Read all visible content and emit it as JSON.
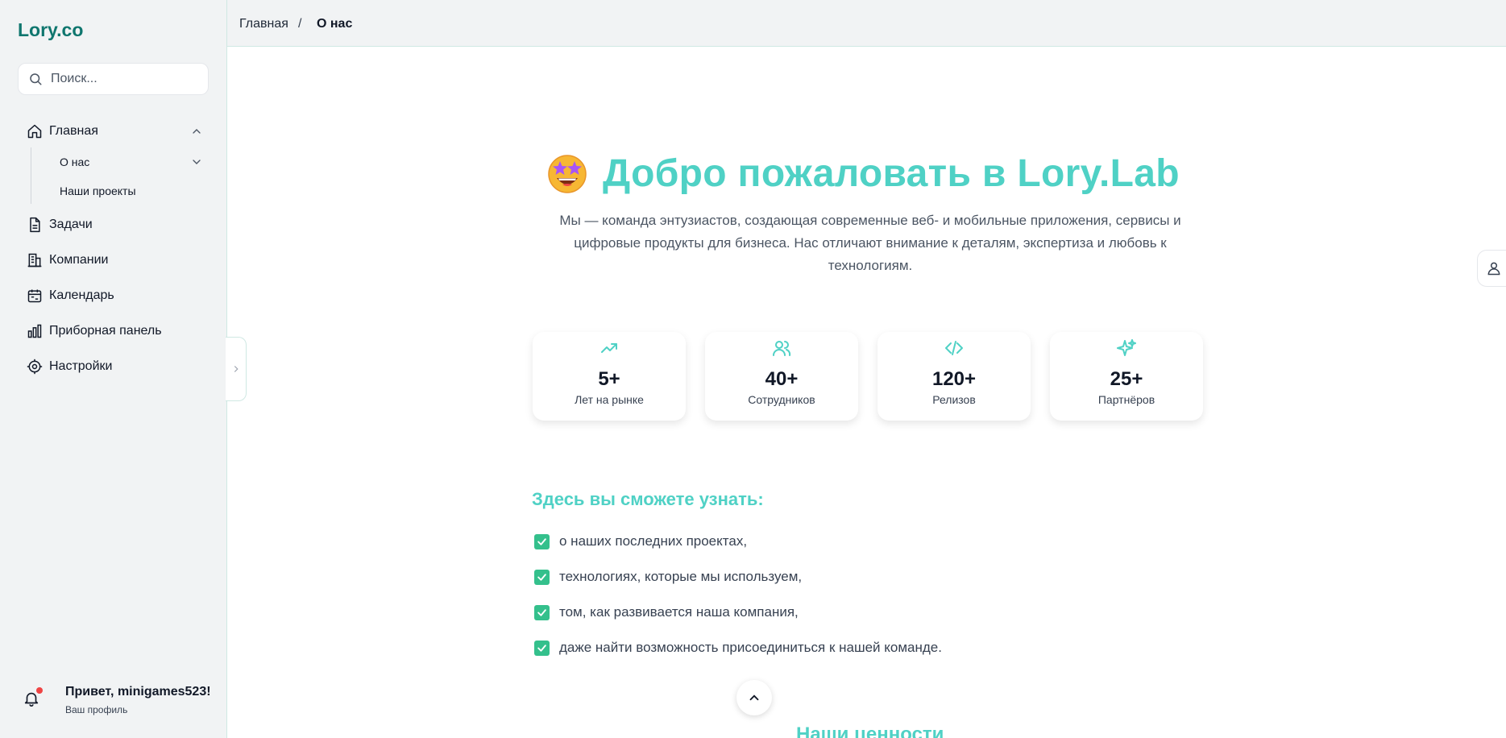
{
  "app": {
    "logo": "Lory.co"
  },
  "search": {
    "placeholder": "Поиск..."
  },
  "nav": {
    "items": [
      {
        "label": "Главная",
        "icon": "home-icon",
        "expanded": true
      },
      {
        "label": "Задачи",
        "icon": "document-icon"
      },
      {
        "label": "Компании",
        "icon": "building-icon"
      },
      {
        "label": "Календарь",
        "icon": "calendar-icon"
      },
      {
        "label": "Приборная панель",
        "icon": "bar-chart-icon"
      },
      {
        "label": "Настройки",
        "icon": "gear-icon"
      }
    ],
    "subitems": [
      {
        "label": "О нас",
        "icon": "chevron-down-icon"
      },
      {
        "label": "Наши проекты"
      }
    ]
  },
  "user": {
    "greeting": "Привет, minigames523!",
    "subtitle": "Ваш профиль"
  },
  "breadcrumb": {
    "home": "Главная",
    "separator": "/",
    "current": "О нас"
  },
  "hero": {
    "title": "Добро пожаловать в Lory.Lab",
    "description": "Мы — команда энтузиастов, создающая современные веб- и мобильные приложения, сервисы и цифровые продукты для бизнеса. Нас отличают внимание к деталям, экспертиза и любовь к технологиям."
  },
  "stats": [
    {
      "value": "5+",
      "label": "Лет на рынке",
      "icon": "trending-up-icon"
    },
    {
      "value": "40+",
      "label": "Сотрудников",
      "icon": "users-icon"
    },
    {
      "value": "120+",
      "label": "Релизов",
      "icon": "code-icon"
    },
    {
      "value": "25+",
      "label": "Партнёров",
      "icon": "sparkles-icon"
    }
  ],
  "learn": {
    "title": "Здесь вы сможете узнать:",
    "items": [
      "о наших последних проектах,",
      "технологиях, которые мы используем,",
      "том, как развивается наша компания,",
      "даже найти возможность присоединиться к нашей команде."
    ]
  },
  "next_section": {
    "title": "Наши ценности"
  },
  "colors": {
    "accent": "#4fd1c5",
    "brand": "#0f766e",
    "check": "#34c08c",
    "notification": "#ef4444"
  }
}
